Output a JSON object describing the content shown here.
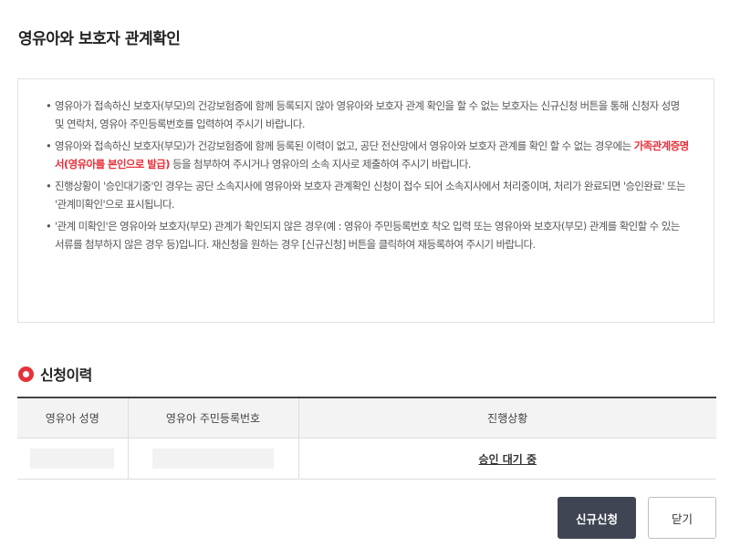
{
  "page": {
    "title": "영유아와 보호자 관계확인"
  },
  "notice": {
    "item1": "영유아가 접속하신 보호자(부모)의 건강보험증에 함께 등록되지 않아 영유아와 보호자 관계 확인을 할 수 없는 보호자는 신규신청 버튼을 통해 신청자 성명 및 연락처, 영유아 주민등록번호를 입력하여 주시기 바랍니다.",
    "item2_before": "영유아와 접속하신 보호자(부모)가 건강보험증에 함께 등록된 이력이 없고, 공단 전산망에서 영유아와 보호자 관계를 확인 할 수 없는 경우에는 ",
    "item2_highlight": "가족관계증명서(영유아를 본인으로 발급)",
    "item2_after": " 등을 첨부하여 주시거나 영유아의 소속 지사로 제출하여 주시기 바랍니다.",
    "item3": "진행상황이 '승인대기중'인 경우는 공단 소속지사에 영유아와 보호자 관계확인 신청이 접수 되어 소속지사에서 처리중이며, 처리가 완료되면 '승인완료' 또는 '관계미확인'으로 표시됩니다.",
    "item4": "'관계 미확인'은 영유아와 보호자(부모) 관계가 확인되지 않은 경우(예 : 영유아 주민등록번호 착오 입력 또는 영유아와 보호자(부모) 관계를 확인할 수 있는 서류를 첨부하지 않은 경우 등)입니다. 재신청을 원하는 경우 [신규신청] 버튼을 클릭하여 재등록하여 주시기 바랍니다."
  },
  "history": {
    "title": "신청이력",
    "columns": {
      "name": "영유아 성명",
      "rrn": "영유아 주민등록번호",
      "status": "진행상황"
    },
    "rows": [
      {
        "name": "",
        "rrn": "",
        "status": "승인 대기 중"
      }
    ]
  },
  "buttons": {
    "new": "신규신청",
    "close": "닫기"
  },
  "colors": {
    "highlight": "#e8303a",
    "primary_button": "#3f4553",
    "section_icon": "#e4323b"
  }
}
